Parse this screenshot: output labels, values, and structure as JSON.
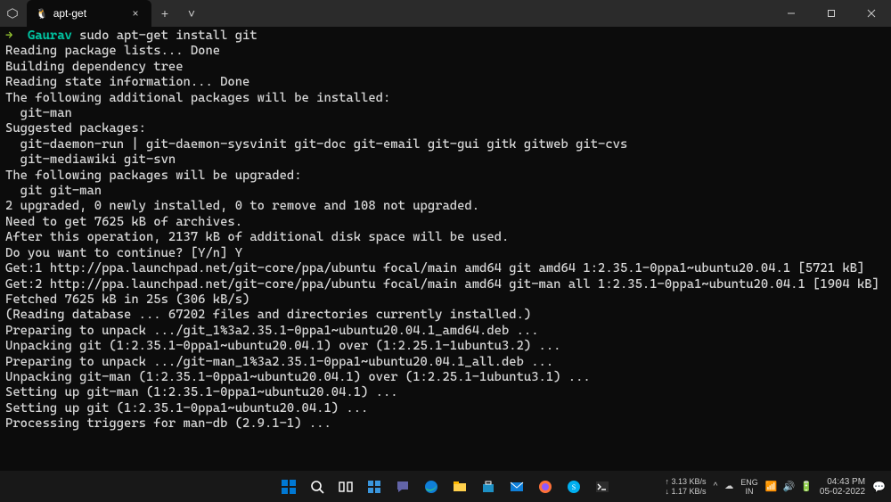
{
  "titlebar": {
    "tab_icon": "🐧",
    "tab_title": "apt-get",
    "close_glyph": "×",
    "newtab_glyph": "+",
    "dropdown_glyph": "˅"
  },
  "terminal": {
    "prompt_arrow": "→  ",
    "prompt_user": "Gaurav ",
    "command": "sudo apt-get install git",
    "lines": [
      "Reading package lists... Done",
      "Building dependency tree",
      "Reading state information... Done",
      "The following additional packages will be installed:",
      "  git-man",
      "Suggested packages:",
      "  git-daemon-run | git-daemon-sysvinit git-doc git-email git-gui gitk gitweb git-cvs",
      "  git-mediawiki git-svn",
      "The following packages will be upgraded:",
      "  git git-man",
      "2 upgraded, 0 newly installed, 0 to remove and 108 not upgraded.",
      "Need to get 7625 kB of archives.",
      "After this operation, 2137 kB of additional disk space will be used.",
      "Do you want to continue? [Y/n] Y",
      "Get:1 http://ppa.launchpad.net/git-core/ppa/ubuntu focal/main amd64 git amd64 1:2.35.1-0ppa1~ubuntu20.04.1 [5721 kB]",
      "Get:2 http://ppa.launchpad.net/git-core/ppa/ubuntu focal/main amd64 git-man all 1:2.35.1-0ppa1~ubuntu20.04.1 [1904 kB]",
      "Fetched 7625 kB in 25s (306 kB/s)",
      "(Reading database ... 67202 files and directories currently installed.)",
      "Preparing to unpack .../git_1%3a2.35.1-0ppa1~ubuntu20.04.1_amd64.deb ...",
      "Unpacking git (1:2.35.1-0ppa1~ubuntu20.04.1) over (1:2.25.1-1ubuntu3.2) ...",
      "Preparing to unpack .../git-man_1%3a2.35.1-0ppa1~ubuntu20.04.1_all.deb ...",
      "Unpacking git-man (1:2.35.1-0ppa1~ubuntu20.04.1) over (1:2.25.1-1ubuntu3.1) ...",
      "Setting up git-man (1:2.35.1-0ppa1~ubuntu20.04.1) ...",
      "Setting up git (1:2.35.1-0ppa1~ubuntu20.04.1) ...",
      "Processing triggers for man-db (2.9.1-1) ..."
    ]
  },
  "taskbar": {
    "net_up": "↑ 3.13 KB/s",
    "net_down": "↓ 1.17 KB/s",
    "chevron": "^",
    "cloud": "☁",
    "lang_top": "ENG",
    "lang_bottom": "IN",
    "wifi": "📶",
    "vol": "🔊",
    "batt": "🔋",
    "time": "04:43 PM",
    "date": "05-02-2022",
    "bell": "💬"
  }
}
